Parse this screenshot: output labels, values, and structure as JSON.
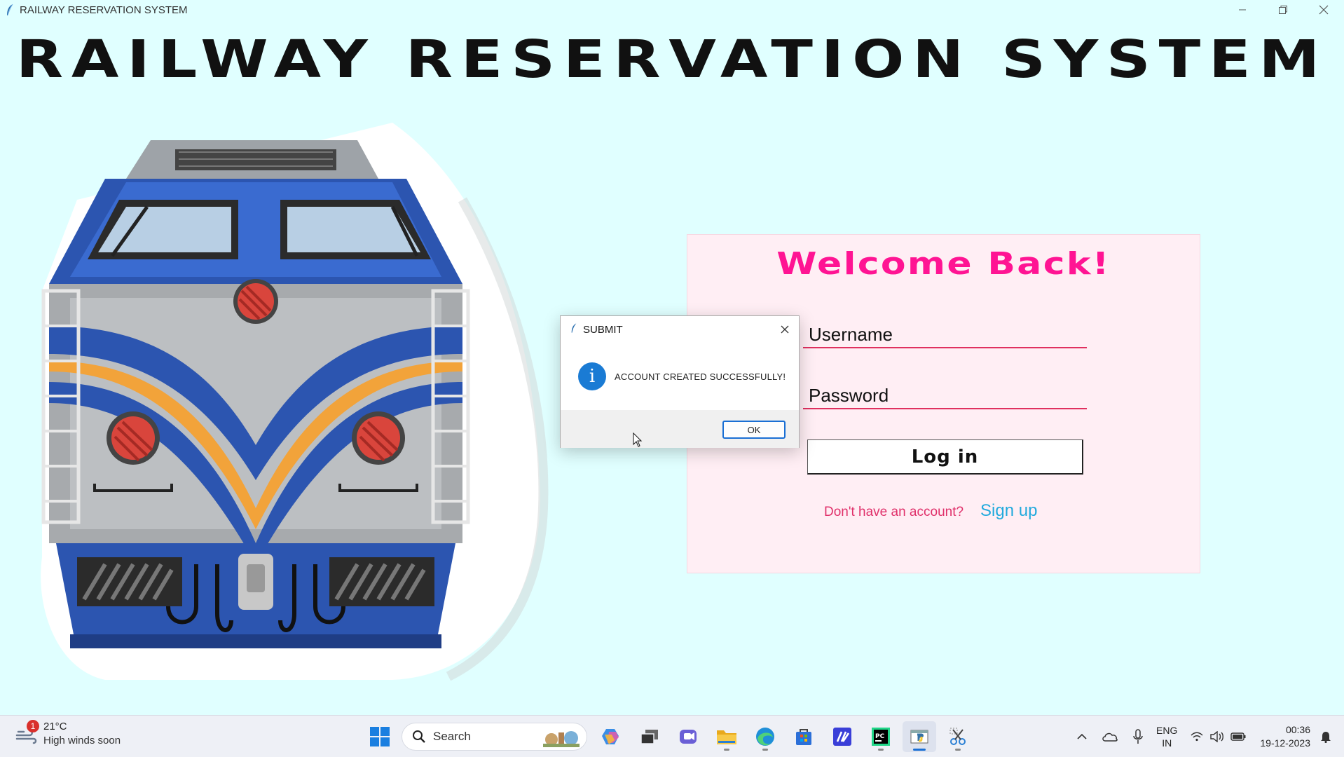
{
  "window": {
    "title": "RAILWAY RESERVATION SYSTEM",
    "app_icon": "feather-icon"
  },
  "app": {
    "heading": "RAILWAY RESERVATION SYSTEM",
    "illustration": "train-front-icon"
  },
  "login": {
    "welcome": "Welcome Back!",
    "username_label": "Username",
    "password_label": "Password",
    "login_button": "Log in",
    "no_account_text": "Don't have an account?",
    "signup_link": "Sign up",
    "colors": {
      "accent": "#ff1493",
      "link": "#22aadd",
      "card_bg": "#ffeef4"
    }
  },
  "dialog": {
    "title": "SUBMIT",
    "message": "ACCOUNT CREATED SUCCESSFULLY!",
    "icon": "info-icon",
    "ok_button": "OK"
  },
  "taskbar": {
    "weather": {
      "temp": "21°C",
      "forecast": "High winds soon",
      "badge": "1"
    },
    "search_placeholder": "Search",
    "apps": [
      "start-icon",
      "copilot-icon",
      "task-view-icon",
      "teams-icon",
      "file-explorer-icon",
      "edge-icon",
      "store-icon",
      "visual-studio-icon",
      "pycharm-icon",
      "python-app-icon",
      "snipping-tool-icon"
    ],
    "language": {
      "line1": "ENG",
      "line2": "IN"
    },
    "clock": {
      "time": "00:36",
      "date": "19-12-2023"
    }
  }
}
